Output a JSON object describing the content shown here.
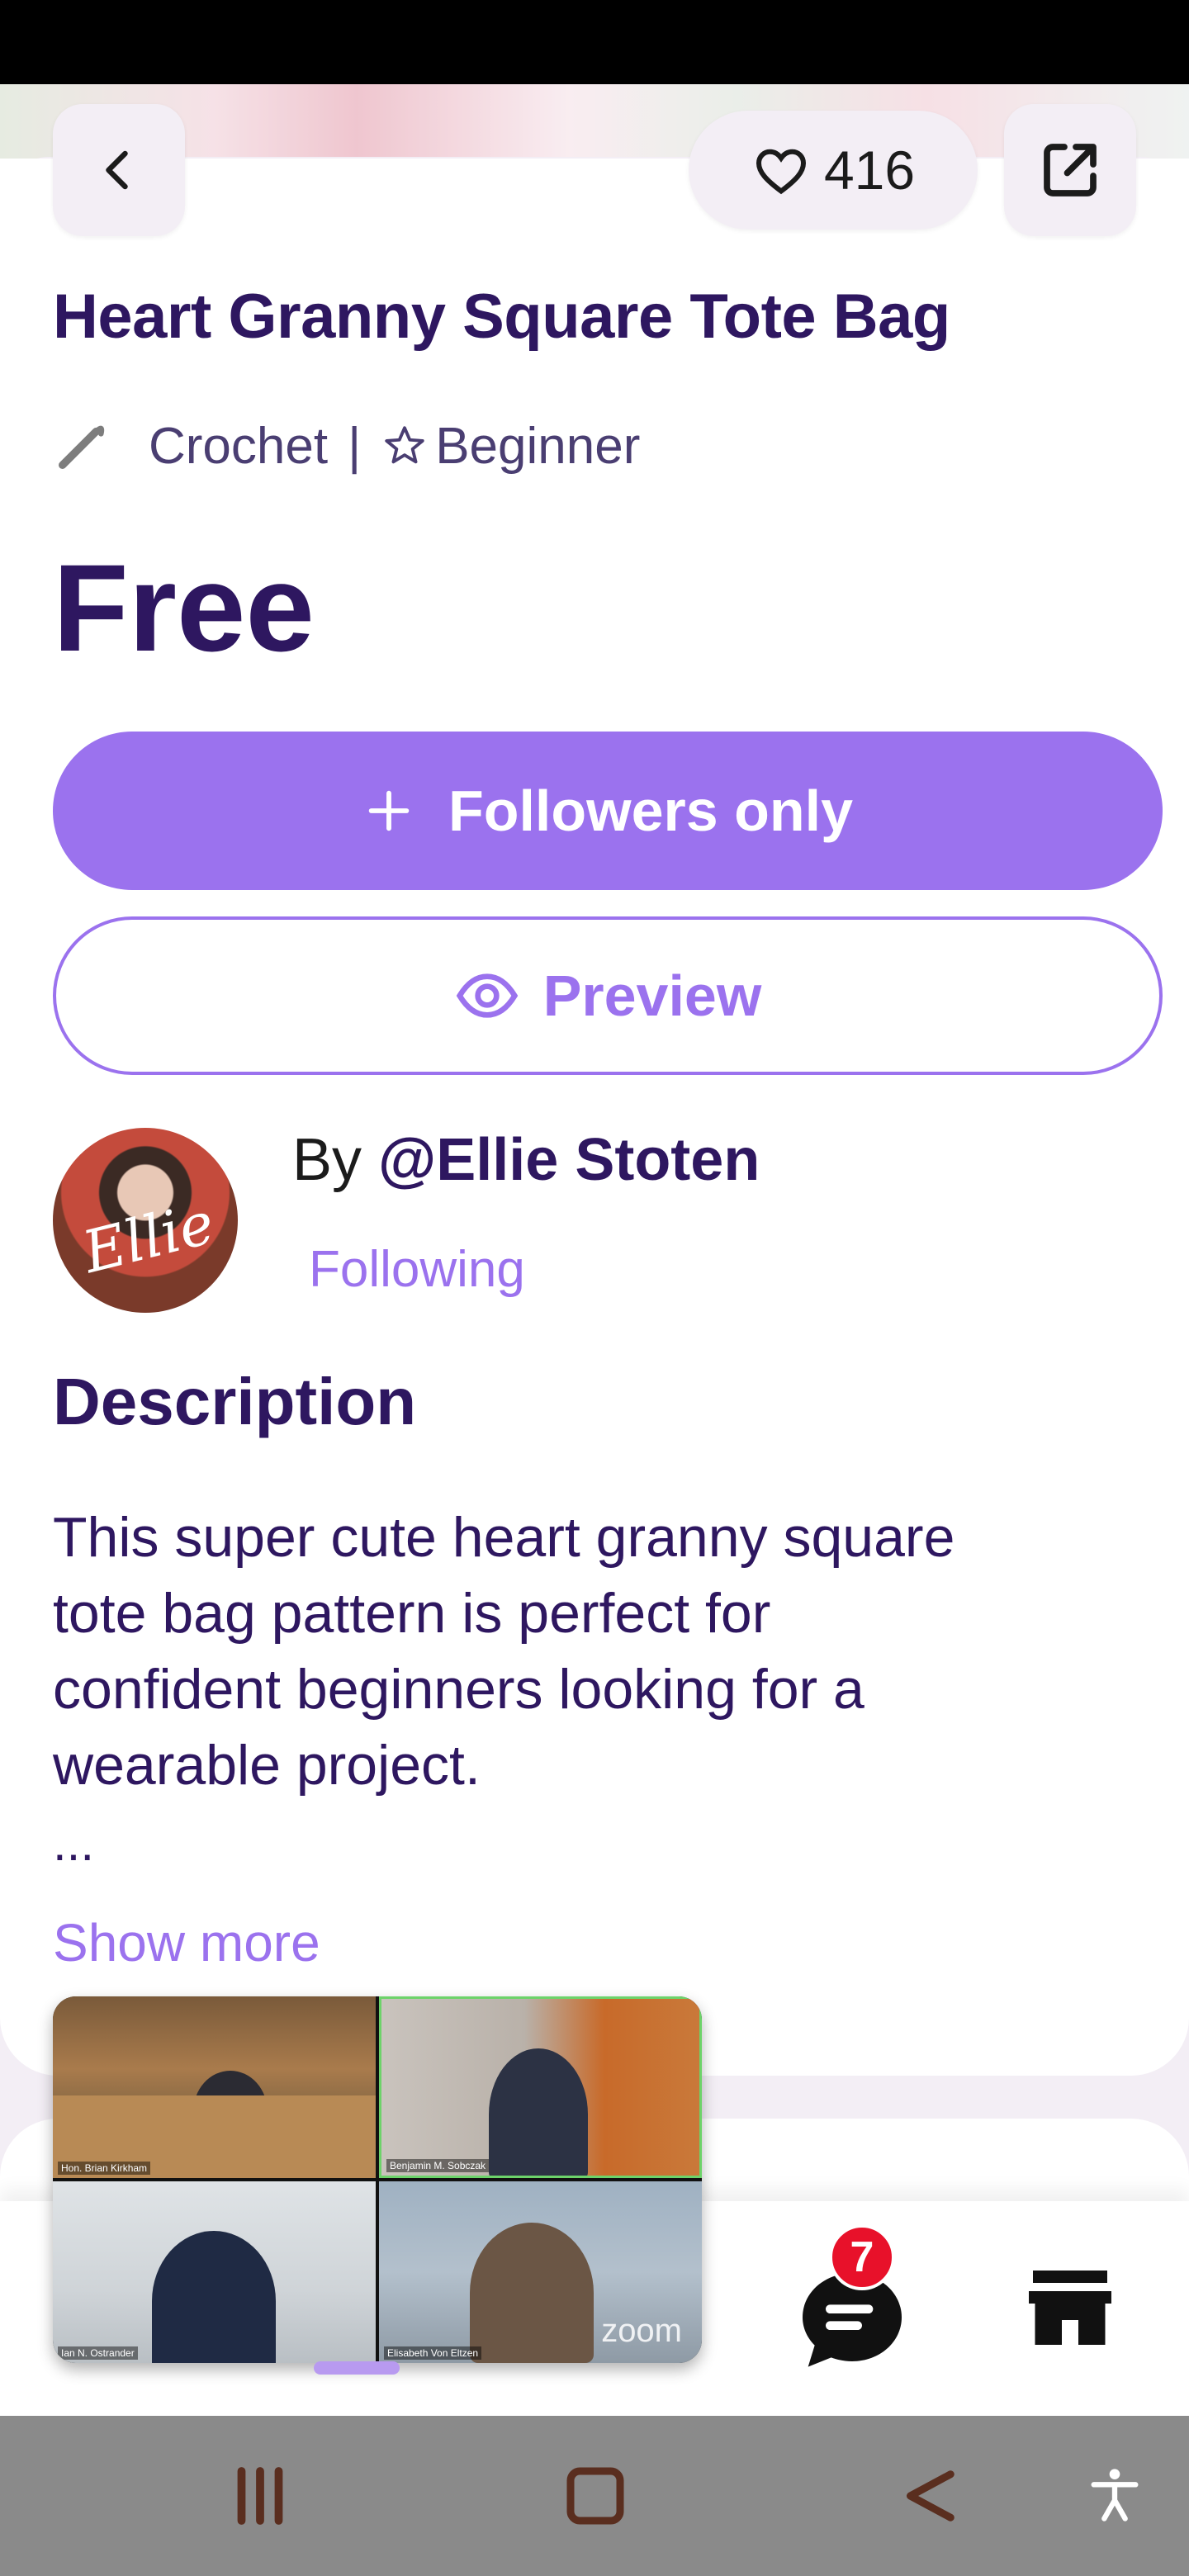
{
  "header": {
    "like_count": "416",
    "carousel_dots": 8,
    "carousel_active": 6
  },
  "pattern": {
    "title": "Heart Granny Square Tote Bag",
    "craft": "Crochet",
    "separator": "|",
    "level": "Beginner",
    "price": "Free"
  },
  "actions": {
    "follow_label": "Followers only",
    "preview_label": "Preview"
  },
  "author": {
    "by_prefix": "By ",
    "handle": "@Ellie Stoten",
    "follow_status": "Following",
    "avatar_text": "Ellie"
  },
  "description": {
    "heading": "Description",
    "lines": [
      "This super cute heart granny square",
      "tote bag pattern is perfect for",
      "confident beginners looking for a",
      "wearable project."
    ],
    "ellipsis": "...",
    "show_more": "Show more"
  },
  "bottom_nav": {
    "chat_badge": "7"
  },
  "video_call": {
    "participants": [
      "Hon. Brian Kirkham",
      "Benjamin M. Sobczak",
      "Ian N. Ostrander",
      "Elisabeth Von Eltzen"
    ],
    "brand": "zoom"
  },
  "colors": {
    "accent": "#9b72ee",
    "title": "#2e1760",
    "badge": "#e8112a",
    "background": "#f3eef5"
  }
}
